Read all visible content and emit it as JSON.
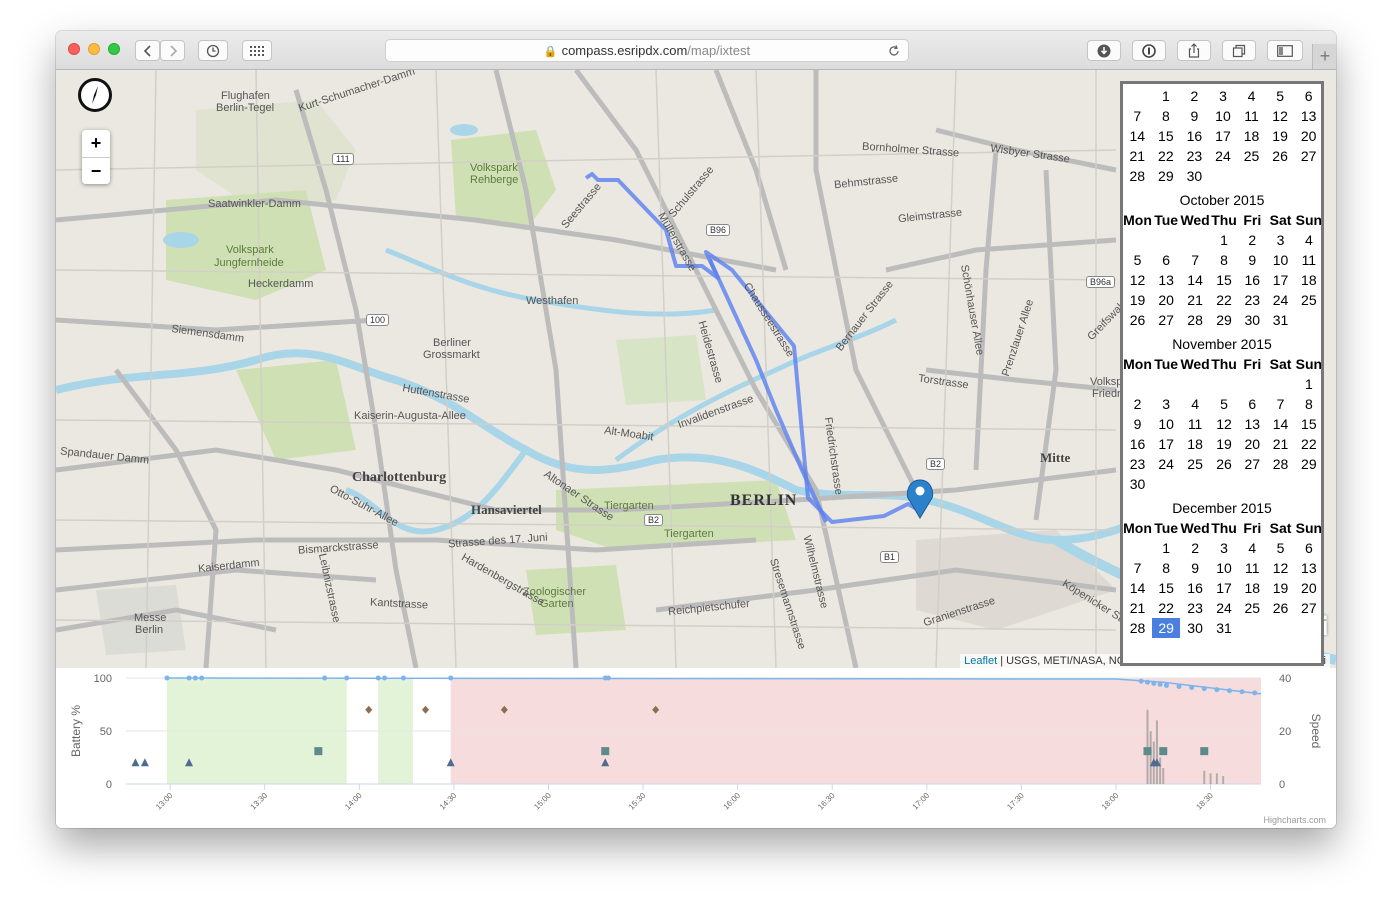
{
  "browser": {
    "url_host": "compass.esripdx.com",
    "url_path": "/map/ixtest",
    "new_tab": "+"
  },
  "map": {
    "zoom_in": "+",
    "zoom_out": "−",
    "attribution_link": "Leaflet",
    "attribution_text": " | USGS, METI/NASA, NGA, INCREMENT P, DeLorme, HERE, Esri",
    "esri_logo": "esri",
    "labels": [
      {
        "text": "Flughafen"
      },
      {
        "text": "Berlin-Tegel"
      },
      {
        "text": "Kurt-Schumacher-Damm"
      },
      {
        "text": "Volkspark"
      },
      {
        "text": "Rehberge"
      },
      {
        "text": "Saatwinkler-Damm"
      },
      {
        "text": "Volkspark"
      },
      {
        "text": "Jungfernheide"
      },
      {
        "text": "Heckerdamm"
      },
      {
        "text": "Westhafen"
      },
      {
        "text": "Berliner"
      },
      {
        "text": "Grossmarkt"
      },
      {
        "text": "Siemensdamm"
      },
      {
        "text": "Huttenstrasse"
      },
      {
        "text": "Kaiserin-Augusta-Allee"
      },
      {
        "text": "Alt-Moabit"
      },
      {
        "text": "Charlottenburg"
      },
      {
        "text": "Hansaviertel"
      },
      {
        "text": "BERLIN"
      },
      {
        "text": "Tiergarten"
      },
      {
        "text": "Tiergarten"
      },
      {
        "text": "Strasse des 17. Juni"
      },
      {
        "text": "Bismarckstrasse"
      },
      {
        "text": "Kantstrasse"
      },
      {
        "text": "Zoologischer"
      },
      {
        "text": "Garten"
      },
      {
        "text": "Messe"
      },
      {
        "text": "Berlin"
      },
      {
        "text": "Mitte"
      },
      {
        "text": "Torstrasse"
      },
      {
        "text": "Bornholmer Strasse"
      },
      {
        "text": "Wisbyer Strasse"
      },
      {
        "text": "Behmstrasse"
      },
      {
        "text": "Gleimstrasse"
      },
      {
        "text": "Invalidenstrasse"
      },
      {
        "text": "Chausseestrasse"
      },
      {
        "text": "Friedrichstrasse"
      },
      {
        "text": "Müllerstrasse"
      },
      {
        "text": "Seestrasse"
      },
      {
        "text": "Schulstrasse"
      },
      {
        "text": "Reichpietschufer"
      },
      {
        "text": "Wilhelmstrasse"
      },
      {
        "text": "Spandauer Damm"
      },
      {
        "text": "Kaiserdamm"
      },
      {
        "text": "Otto-Suhr-Allee"
      },
      {
        "text": "Hardenbergstrasse"
      },
      {
        "text": "Altonaer Strasse"
      },
      {
        "text": "Heidestrasse"
      },
      {
        "text": "Bernauer Strasse"
      },
      {
        "text": "Schönhauser Allee"
      },
      {
        "text": "Greifswalder Strasse"
      },
      {
        "text": "Prenzlauer Allee"
      },
      {
        "text": "Köpenicker Strasse"
      },
      {
        "text": "Granienstrasse"
      },
      {
        "text": "Stresemannstrasse"
      },
      {
        "text": "Leibnizstrasse"
      },
      {
        "text": "Volkspark"
      },
      {
        "text": "Friedrich"
      }
    ],
    "road_shields": [
      "111",
      "100",
      "B96",
      "B2",
      "B2",
      "B1",
      "B96a"
    ]
  },
  "calendar": {
    "weekdays": [
      "Mon",
      "Tue",
      "Wed",
      "Thu",
      "Fri",
      "Sat",
      "Sun"
    ],
    "months": [
      {
        "title": "",
        "rows": [
          [
            "",
            "1",
            "2",
            "3",
            "4",
            "5",
            "6"
          ],
          [
            "7",
            "8",
            "9",
            "10",
            "11",
            "12",
            "13"
          ],
          [
            "14",
            "15",
            "16",
            "17",
            "18",
            "19",
            "20"
          ],
          [
            "21",
            "22",
            "23",
            "24",
            "25",
            "26",
            "27"
          ],
          [
            "28",
            "29",
            "30",
            "",
            "",
            "",
            ""
          ]
        ],
        "show_header": false
      },
      {
        "title": "October 2015",
        "rows": [
          [
            "",
            "",
            "",
            "1",
            "2",
            "3",
            "4"
          ],
          [
            "5",
            "6",
            "7",
            "8",
            "9",
            "10",
            "11"
          ],
          [
            "12",
            "13",
            "14",
            "15",
            "16",
            "17",
            "18"
          ],
          [
            "19",
            "20",
            "21",
            "22",
            "23",
            "24",
            "25"
          ],
          [
            "26",
            "27",
            "28",
            "29",
            "30",
            "31",
            ""
          ]
        ],
        "show_header": true
      },
      {
        "title": "November 2015",
        "rows": [
          [
            "",
            "",
            "",
            "",
            "",
            "",
            "1"
          ],
          [
            "2",
            "3",
            "4",
            "5",
            "6",
            "7",
            "8"
          ],
          [
            "9",
            "10",
            "11",
            "12",
            "13",
            "14",
            "15"
          ],
          [
            "16",
            "17",
            "18",
            "19",
            "20",
            "21",
            "22"
          ],
          [
            "23",
            "24",
            "25",
            "26",
            "27",
            "28",
            "29"
          ],
          [
            "30",
            "",
            "",
            "",
            "",
            "",
            ""
          ]
        ],
        "show_header": true
      },
      {
        "title": "December 2015",
        "rows": [
          [
            "",
            "1",
            "2",
            "3",
            "4",
            "5",
            "6"
          ],
          [
            "7",
            "8",
            "9",
            "10",
            "11",
            "12",
            "13"
          ],
          [
            "14",
            "15",
            "16",
            "17",
            "18",
            "19",
            "20"
          ],
          [
            "21",
            "22",
            "23",
            "24",
            "25",
            "26",
            "27"
          ],
          [
            "28",
            "29",
            "30",
            "31",
            "",
            "",
            ""
          ]
        ],
        "show_header": true,
        "selected": "29"
      }
    ],
    "selected_color": "#4a7fe0"
  },
  "chart_data": {
    "type": "scatter",
    "credits": "Highcharts.com",
    "y_left": {
      "label": "Battery %",
      "range": [
        0,
        100
      ],
      "ticks": [
        "0",
        "50",
        "100"
      ]
    },
    "y_right": {
      "label": "Speed",
      "range": [
        0,
        40
      ],
      "ticks": [
        "0",
        "20",
        "40"
      ]
    },
    "x_range": [
      "12:46",
      "18:46"
    ],
    "x_ticks": [
      "13:00",
      "13:30",
      "14:00",
      "14:30",
      "15:00",
      "15:30",
      "16:00",
      "16:30",
      "17:00",
      "17:30",
      "18:00",
      "18:30"
    ],
    "bands": [
      {
        "from": "12:59",
        "to": "13:56",
        "color": "#e2f3d8"
      },
      {
        "from": "14:06",
        "to": "14:17",
        "color": "#e2f3d8"
      },
      {
        "from": "14:29",
        "to": "18:46",
        "color": "#f6dcdc"
      }
    ],
    "battery_line": [
      {
        "t": "12:59",
        "v": 100
      },
      {
        "t": "18:00",
        "v": 99
      },
      {
        "t": "18:15",
        "v": 96
      },
      {
        "t": "18:46",
        "v": 85
      }
    ],
    "battery_points": [
      {
        "t": "12:59",
        "v": 100
      },
      {
        "t": "13:06",
        "v": 100
      },
      {
        "t": "13:08",
        "v": 100
      },
      {
        "t": "13:10",
        "v": 100
      },
      {
        "t": "13:49",
        "v": 100
      },
      {
        "t": "13:56",
        "v": 100
      },
      {
        "t": "14:06",
        "v": 100
      },
      {
        "t": "14:08",
        "v": 100
      },
      {
        "t": "14:14",
        "v": 100
      },
      {
        "t": "14:29",
        "v": 100
      },
      {
        "t": "15:18",
        "v": 100
      },
      {
        "t": "15:19",
        "v": 100
      },
      {
        "t": "18:08",
        "v": 97
      },
      {
        "t": "18:10",
        "v": 96
      },
      {
        "t": "18:12",
        "v": 95
      },
      {
        "t": "18:14",
        "v": 94
      },
      {
        "t": "18:16",
        "v": 93
      },
      {
        "t": "18:20",
        "v": 92
      },
      {
        "t": "18:24",
        "v": 91
      },
      {
        "t": "18:28",
        "v": 90
      },
      {
        "t": "18:32",
        "v": 89
      },
      {
        "t": "18:36",
        "v": 88
      },
      {
        "t": "18:40",
        "v": 87
      },
      {
        "t": "18:44",
        "v": 86
      }
    ],
    "diamonds": [
      {
        "t": "14:03",
        "v": 70
      },
      {
        "t": "14:21",
        "v": 70
      },
      {
        "t": "14:46",
        "v": 70
      },
      {
        "t": "15:34",
        "v": 70
      }
    ],
    "squares": [
      {
        "t": "13:47",
        "v": 31
      },
      {
        "t": "15:18",
        "v": 31
      },
      {
        "t": "18:10",
        "v": 31
      },
      {
        "t": "18:15",
        "v": 31
      },
      {
        "t": "18:28",
        "v": 31
      }
    ],
    "triangles": [
      {
        "t": "12:49",
        "v": 20
      },
      {
        "t": "12:52",
        "v": 20
      },
      {
        "t": "13:06",
        "v": 20
      },
      {
        "t": "14:29",
        "v": 20
      },
      {
        "t": "15:18",
        "v": 20
      },
      {
        "t": "18:12",
        "v": 20
      },
      {
        "t": "18:13",
        "v": 20
      }
    ],
    "speed_bars": [
      {
        "t": "18:10",
        "v": 28
      },
      {
        "t": "18:11",
        "v": 20
      },
      {
        "t": "18:12",
        "v": 16
      },
      {
        "t": "18:13",
        "v": 24
      },
      {
        "t": "18:14",
        "v": 10
      },
      {
        "t": "18:15",
        "v": 6
      },
      {
        "t": "18:28",
        "v": 5
      },
      {
        "t": "18:30",
        "v": 4
      },
      {
        "t": "18:32",
        "v": 4
      },
      {
        "t": "18:34",
        "v": 3
      }
    ],
    "colors": {
      "battery": "#7cb5ec",
      "diamond": "#8d6e4e",
      "square": "#5f8a8b",
      "triangle": "#4f6b8f",
      "speed": "#888888"
    }
  }
}
